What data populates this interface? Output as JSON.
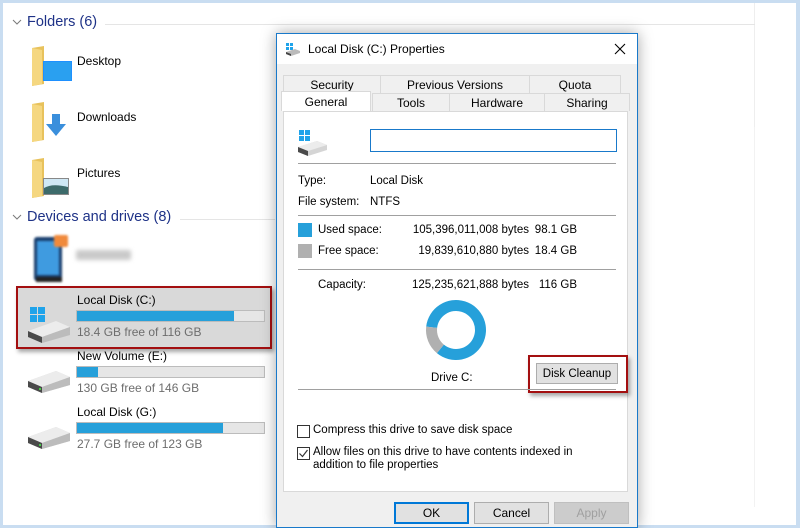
{
  "explorer": {
    "groups": {
      "folders": "Folders (6)",
      "drives": "Devices and drives (8)"
    },
    "folders": [
      {
        "name": "Desktop",
        "icon": "desktop-folder-icon"
      },
      {
        "name": "Downloads",
        "icon": "downloads-folder-icon"
      },
      {
        "name": "Pictures",
        "icon": "pictures-folder-icon"
      }
    ],
    "drives": [
      {
        "name": "Local Disk (C:)",
        "free_text": "18.4 GB free of 116 GB",
        "used_fraction": 0.84,
        "icon": "windows-drive-icon",
        "selected": true
      },
      {
        "name": "New Volume (E:)",
        "free_text": "130 GB free of 146 GB",
        "used_fraction": 0.11,
        "icon": "drive-icon"
      },
      {
        "name": "Local Disk (G:)",
        "free_text": "27.7 GB free of 123 GB",
        "used_fraction": 0.78,
        "icon": "drive-icon"
      }
    ],
    "blurred_device": {
      "icon": "phone-device-icon"
    }
  },
  "dialog": {
    "title": "Local Disk (C:) Properties",
    "tabs_row1": [
      "Security",
      "Previous Versions",
      "Quota"
    ],
    "tabs_row2": [
      "General",
      "Tools",
      "Hardware",
      "Sharing"
    ],
    "active_tab": "General",
    "name_value": "",
    "type_label": "Type:",
    "type_value": "Local Disk",
    "fs_label": "File system:",
    "fs_value": "NTFS",
    "used_label": "Used space:",
    "used_bytes": "105,396,011,008 bytes",
    "used_gb": "98.1 GB",
    "free_label": "Free space:",
    "free_bytes": "19,839,610,880 bytes",
    "free_gb": "18.4 GB",
    "capacity_label": "Capacity:",
    "capacity_bytes": "125,235,621,888 bytes",
    "capacity_gb": "116 GB",
    "used_fraction": 0.842,
    "drive_label": "Drive C:",
    "cleanup_label": "Disk Cleanup",
    "compress_label": "Compress this drive to save disk space",
    "compress_checked": false,
    "index_label": "Allow files on this drive to have contents indexed in addition to file properties",
    "index_checked": true,
    "ok_label": "OK",
    "cancel_label": "Cancel",
    "apply_label": "Apply",
    "colors": {
      "used": "#26a0da",
      "free": "#b0b0b0",
      "highlight": "#a30f10",
      "accent": "#1979ca"
    }
  }
}
